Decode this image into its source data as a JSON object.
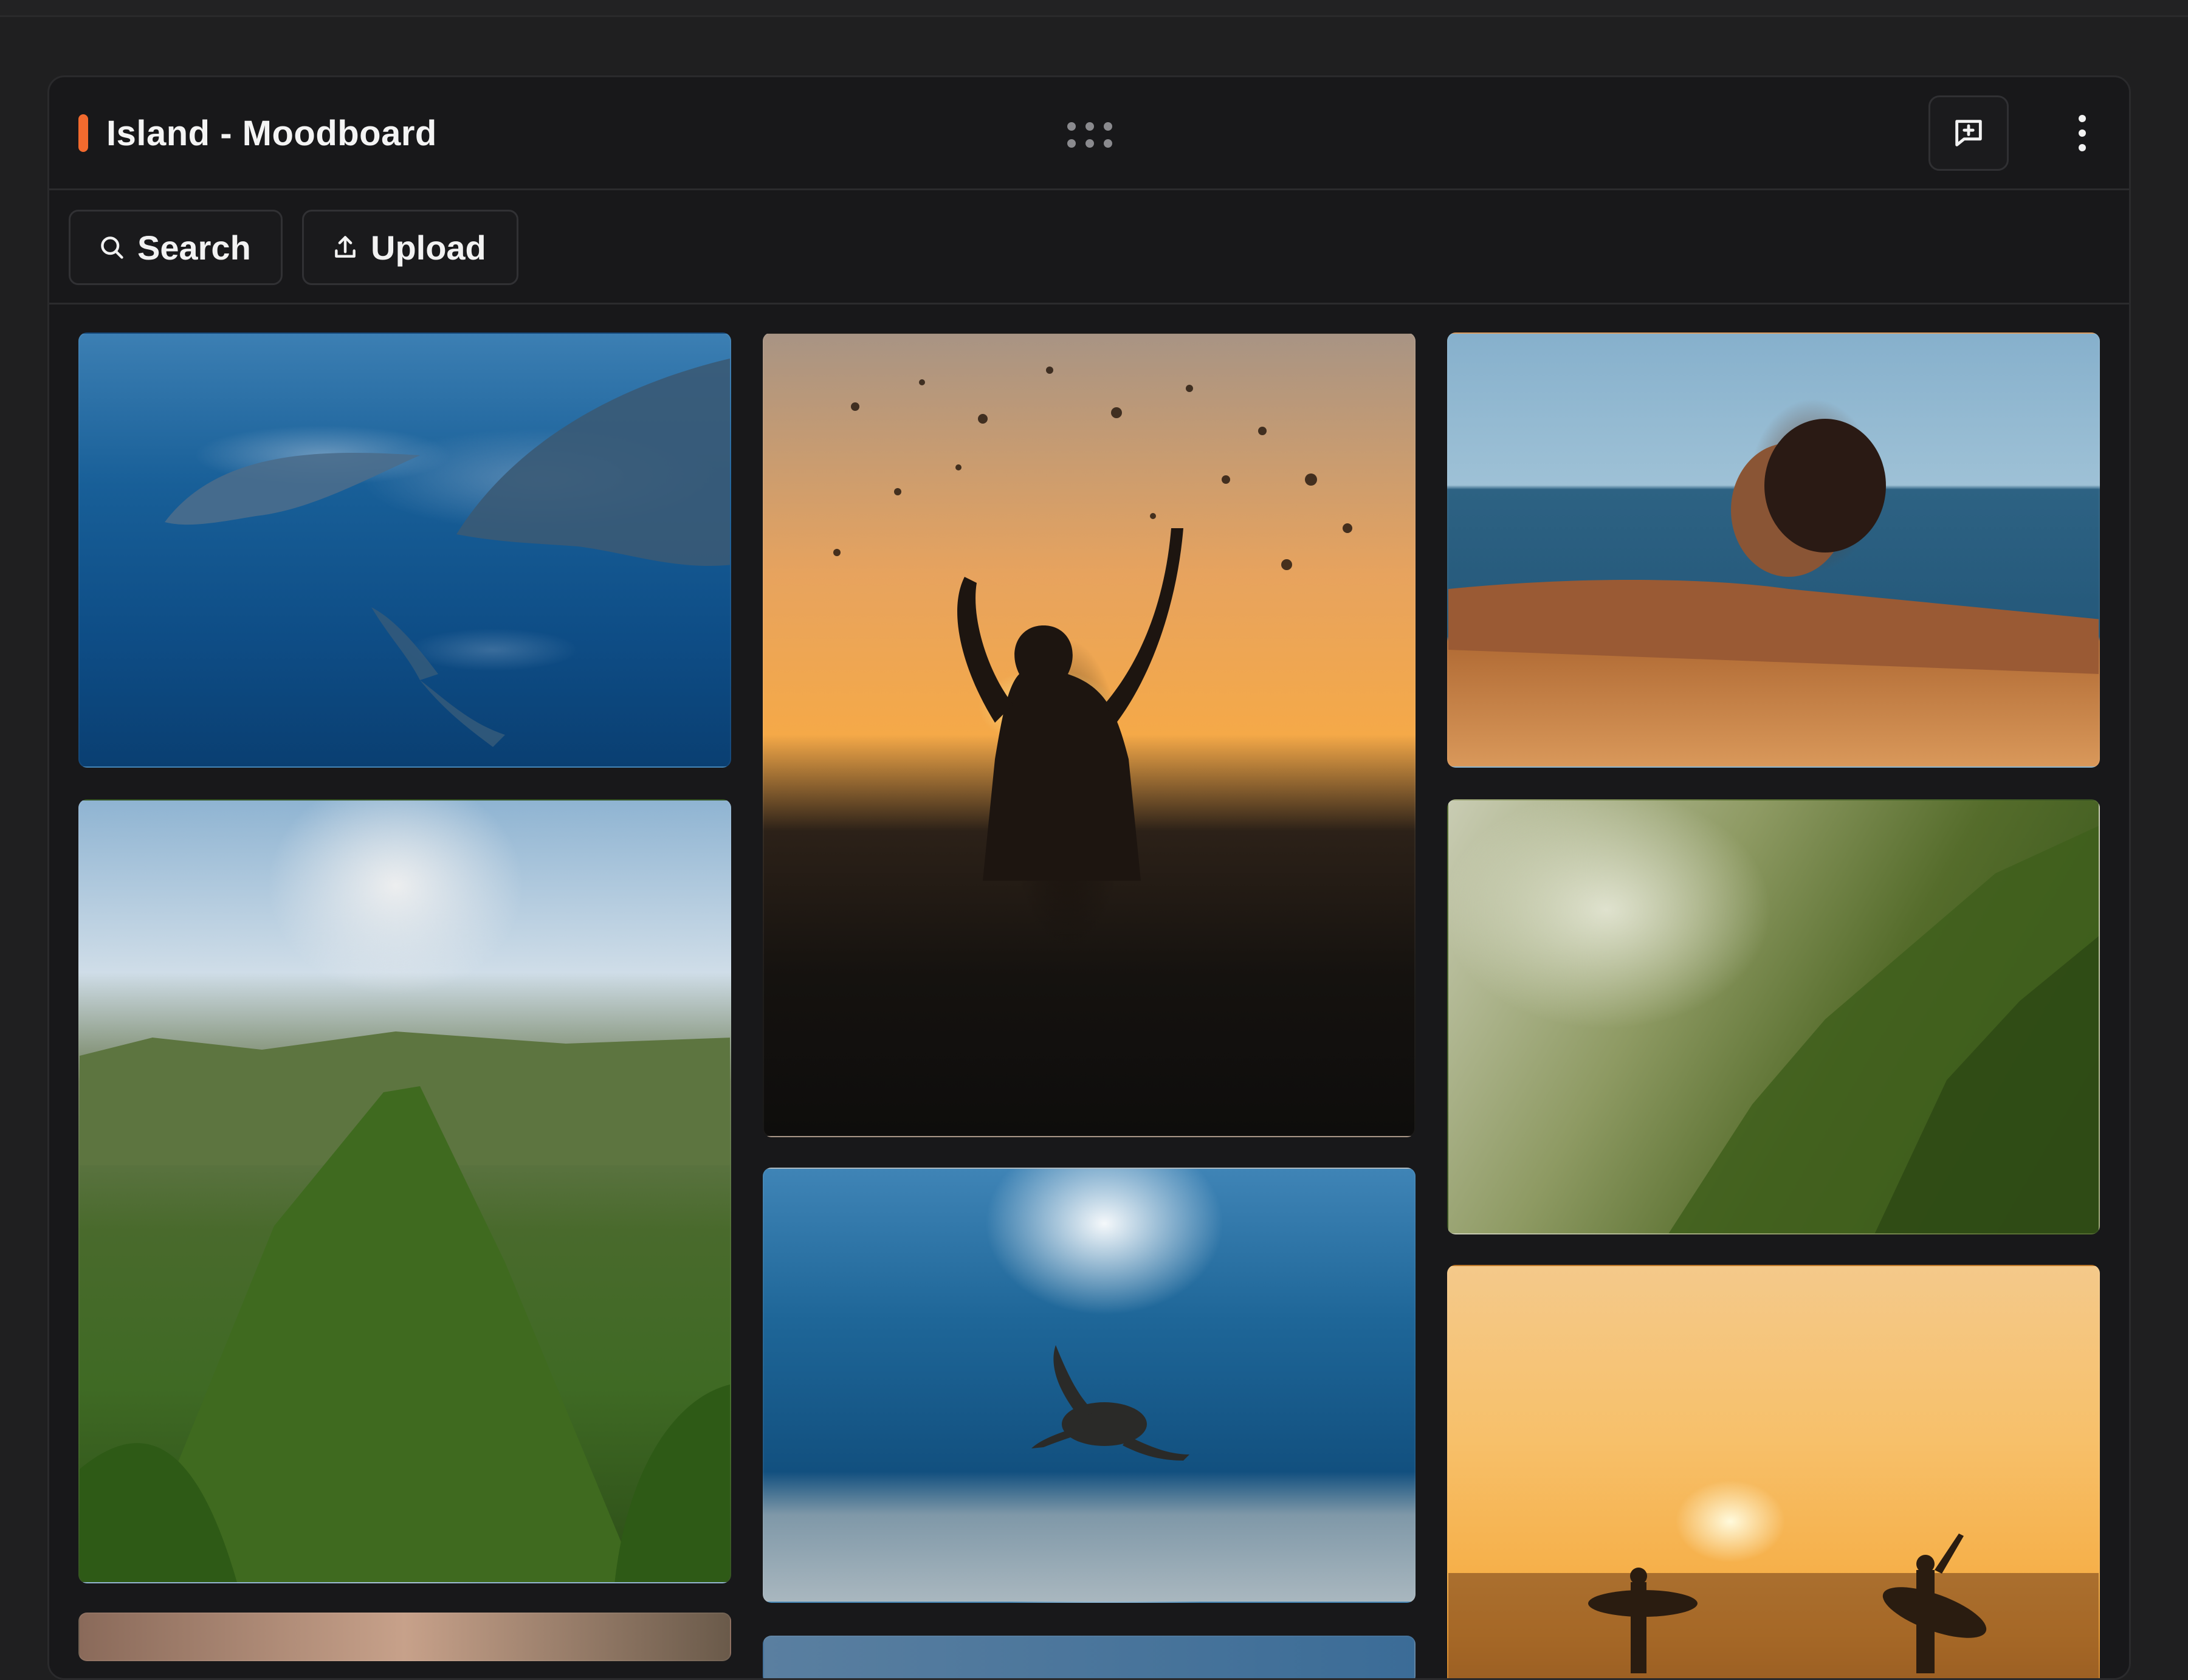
{
  "header": {
    "title": "Island - Moodboard",
    "accent_color": "#f26a2e",
    "drag_handle_icon": "grip-dots-icon",
    "comment_icon": "message-plus-icon",
    "more_icon": "kebab-vertical-icon"
  },
  "toolbar": {
    "search_label": "Search",
    "search_icon": "search-icon",
    "upload_label": "Upload",
    "upload_icon": "upload-icon"
  },
  "photos": [
    {
      "subject": "dolphins"
    },
    {
      "subject": "splash-sunset"
    },
    {
      "subject": "woman-pool"
    },
    {
      "subject": "mountain-peak"
    },
    {
      "subject": "valley"
    },
    {
      "subject": "sea-turtle"
    },
    {
      "subject": "surfers-sunset"
    }
  ]
}
